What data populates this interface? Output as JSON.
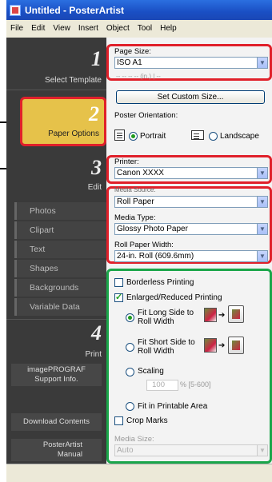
{
  "window": {
    "title": "Untitled - PosterArtist"
  },
  "menu": [
    "File",
    "Edit",
    "View",
    "Insert",
    "Object",
    "Tool",
    "Help"
  ],
  "steps": {
    "s1": {
      "num": "1",
      "label": "Select Template"
    },
    "s2": {
      "num": "2",
      "label": "Paper Options"
    },
    "s3": {
      "num": "3",
      "label": "Edit"
    },
    "s4": {
      "num": "4",
      "label": "Print"
    }
  },
  "edit_items": [
    "Photos",
    "Clipart",
    "Text",
    "Shapes",
    "Backgrounds",
    "Variable Data"
  ],
  "left_buttons": {
    "support": "imagePROGRAF Support Info.",
    "download": "Download Contents",
    "manual": "PosterArtist Manual"
  },
  "page_size": {
    "label": "Page Size:",
    "value": "ISO A1",
    "partial_info": "-- -- -- -- (in.) | --"
  },
  "custom_size_button": "Set Custom Size...",
  "orientation": {
    "label": "Poster Orientation:",
    "portrait": "Portrait",
    "landscape": "Landscape",
    "selected": "Portrait"
  },
  "printer": {
    "label": "Printer:",
    "value": "Canon XXXX"
  },
  "media_source": {
    "label": "Media Source:",
    "value": "Roll Paper"
  },
  "media_type": {
    "label": "Media Type:",
    "value": "Glossy Photo Paper"
  },
  "roll_width": {
    "label": "Roll Paper Width:",
    "value": "24-in. Roll (609.6mm)"
  },
  "options": {
    "borderless": {
      "label": "Borderless Printing",
      "checked": false
    },
    "enlarged": {
      "label": "Enlarged/Reduced Printing",
      "checked": true
    },
    "fit_long": {
      "label": "Fit Long Side to Roll Width",
      "selected": true
    },
    "fit_short": {
      "label": "Fit Short Side to Roll Width",
      "selected": false
    },
    "scaling": {
      "label": "Scaling",
      "selected": false,
      "value": "100",
      "range": "% [5-600]"
    },
    "fit_printable": {
      "label": "Fit in Printable Area",
      "selected": false
    },
    "crop_marks": {
      "label": "Crop Marks",
      "checked": false
    }
  },
  "media_size": {
    "label": "Media Size:",
    "value": "Auto"
  },
  "colors": {
    "highlight": "#e0202a",
    "group": "#1aa64a",
    "active_step": "#e8c040"
  }
}
